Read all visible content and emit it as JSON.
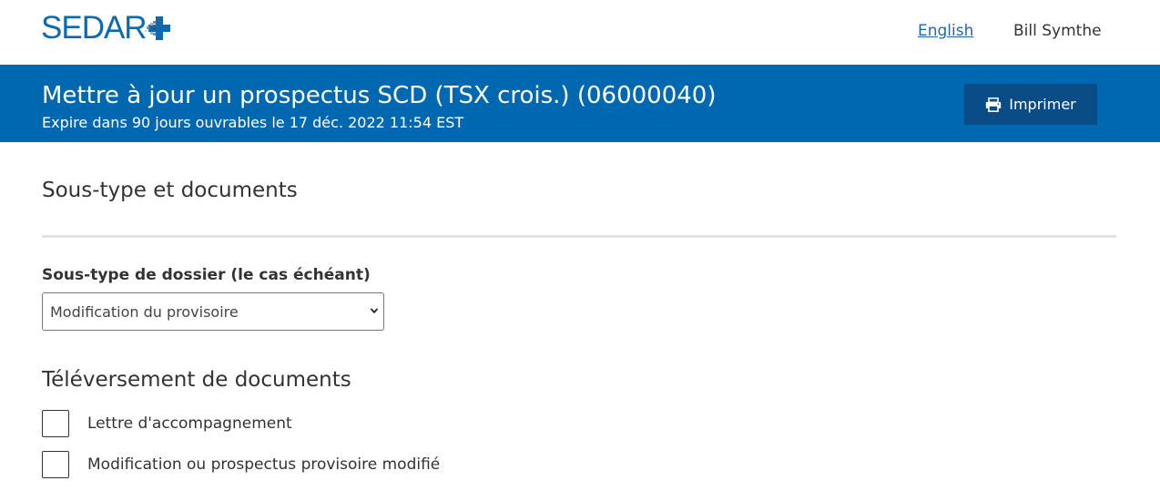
{
  "header": {
    "logo_text": "SEDAR",
    "language_link": "English",
    "user_name": "Bill Symthe"
  },
  "banner": {
    "title": "Mettre à jour un prospectus SCD (TSX crois.) (06000040)",
    "subtitle": "Expire dans 90 jours ouvrables le 17 déc. 2022 11:54 EST",
    "print_label": "Imprimer"
  },
  "section": {
    "title": "Sous-type et documents",
    "subtype_label": "Sous-type de dossier (le cas échéant)",
    "subtype_value": "Modification du provisoire",
    "upload_title": "Téléversement de documents",
    "documents": [
      {
        "label": "Lettre d'accompagnement",
        "checked": false
      },
      {
        "label": "Modification ou prospectus provisoire modifié",
        "checked": false
      }
    ]
  },
  "colors": {
    "brand_blue": "#0067b1",
    "print_button": "#0a4c86",
    "link": "#1f67b0"
  },
  "icons": {
    "logo_mark": "plus-pixel-logo-icon",
    "print": "printer-icon",
    "select": "chevron-down-icon"
  }
}
